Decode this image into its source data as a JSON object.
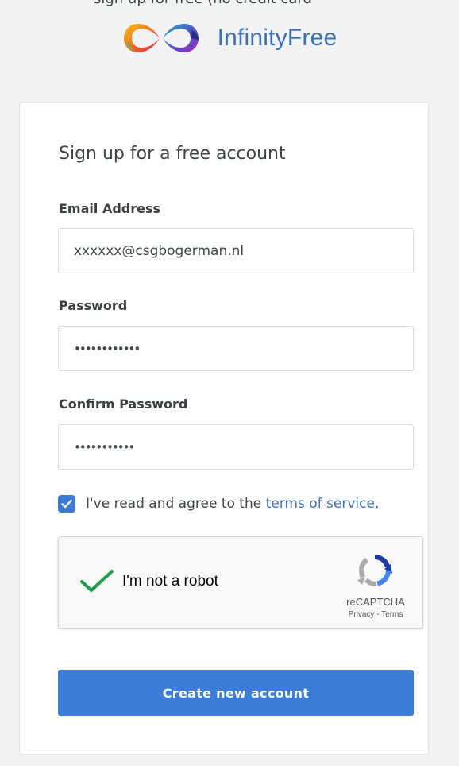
{
  "header": {
    "top_cut_text": "sign up for free (no credit card",
    "brand_name": "InfinityFree"
  },
  "form": {
    "title": "Sign up for a free account",
    "email_label": "Email Address",
    "email_value": "xxxxxx@csgbogerman.nl",
    "password_label": "Password",
    "password_value": "••••••••••••",
    "confirm_label": "Confirm Password",
    "confirm_value": "•••••••••••",
    "agree_text": "I've read and agree to the ",
    "tos_link": "terms of service",
    "agree_suffix": ".",
    "submit_label": "Create new account"
  },
  "recaptcha": {
    "label": "I'm not a robot",
    "brand": "reCAPTCHA",
    "privacy": "Privacy",
    "separator": " - ",
    "terms": "Terms"
  },
  "colors": {
    "brand_text": "#3a72b4",
    "link": "#3f74b5",
    "button": "#3b7dd8",
    "checkbox": "#3a7bd5",
    "recaptcha_check": "#1e9e4a"
  }
}
